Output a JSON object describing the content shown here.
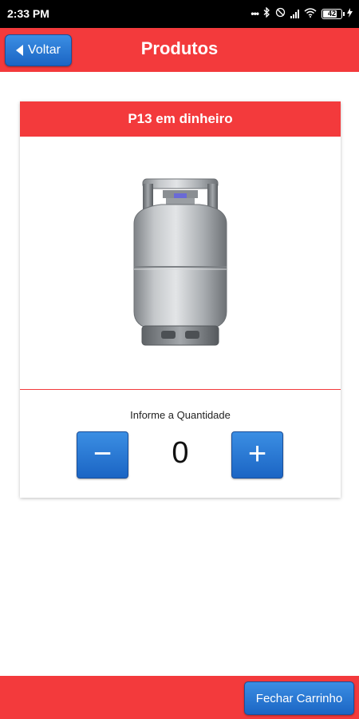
{
  "status_bar": {
    "time": "2:33 PM",
    "battery": "42"
  },
  "header": {
    "back_label": "Voltar",
    "title": "Produtos"
  },
  "product": {
    "name": "P13 em dinheiro",
    "image_icon": "gas-cylinder-icon",
    "quantity_label": "Informe a Quantidade",
    "quantity": "0",
    "decrement_symbol": "−",
    "increment_symbol": "+"
  },
  "footer": {
    "checkout_label": "Fechar Carrinho"
  },
  "colors": {
    "primary_red": "#f33a3c",
    "button_blue": "#2a7ad6"
  }
}
